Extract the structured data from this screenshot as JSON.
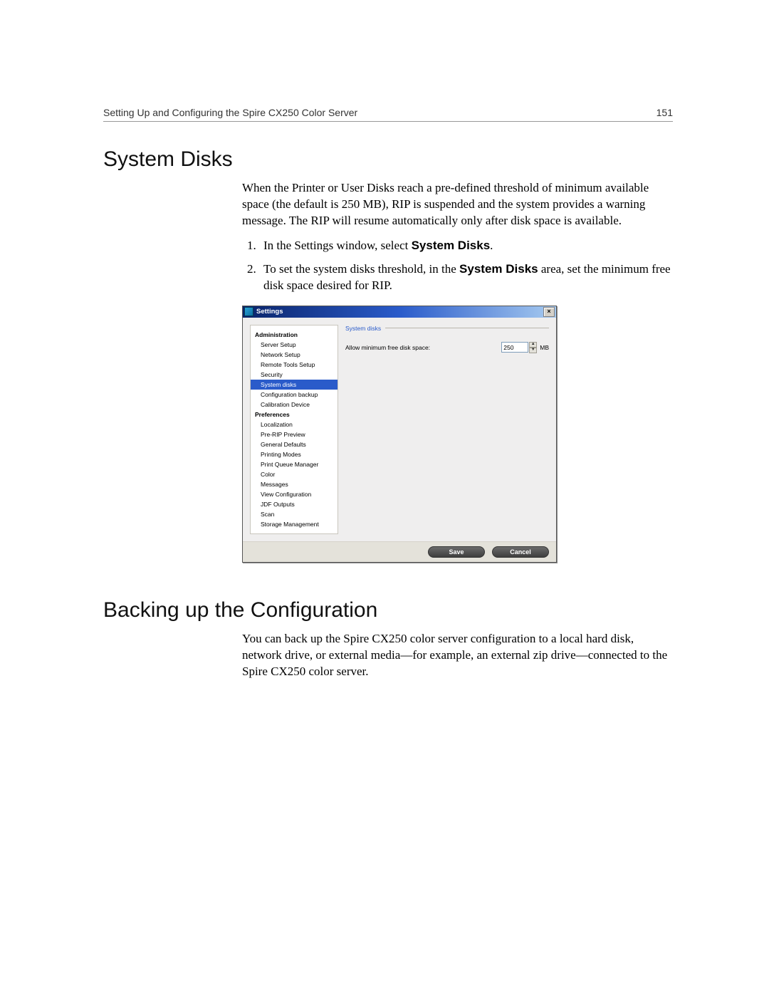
{
  "header": {
    "running_title": "Setting Up and Configuring the Spire CX250 Color Server",
    "page_number": "151"
  },
  "section1": {
    "heading": "System Disks",
    "para1": "When the Printer or User Disks reach a pre-defined threshold of minimum available space (the default is 250 MB), RIP is suspended and the system provides a warning message. The RIP will resume automatically only after disk space is available.",
    "step1_pre": "In the Settings window, select ",
    "step1_bold": "System Disks",
    "step1_post": ".",
    "step2_pre": "To set the system disks threshold, in the ",
    "step2_bold": "System Disks",
    "step2_post": " area, set the minimum free disk space desired for RIP."
  },
  "dialog": {
    "title": "Settings",
    "tree": {
      "group1": "Administration",
      "items1": [
        "Server Setup",
        "Network Setup",
        "Remote Tools Setup",
        "Security",
        "System disks",
        "Configuration backup",
        "Calibration Device"
      ],
      "group2": "Preferences",
      "items2": [
        "Localization",
        "Pre-RIP Preview",
        "General Defaults",
        "Printing Modes",
        "Print Queue Manager",
        "Color",
        "Messages",
        "View Configuration",
        "JDF Outputs",
        "Scan",
        "Storage Management"
      ]
    },
    "panel": {
      "legend": "System disks",
      "label": "Allow minimum free disk space:",
      "value": "250",
      "unit": "MB"
    },
    "buttons": {
      "save": "Save",
      "cancel": "Cancel"
    }
  },
  "section2": {
    "heading": "Backing up the Configuration",
    "para1": "You can back up the Spire CX250 color server configuration to a local hard disk, network drive, or external media—for example, an external zip drive—connected to the Spire CX250 color server."
  }
}
